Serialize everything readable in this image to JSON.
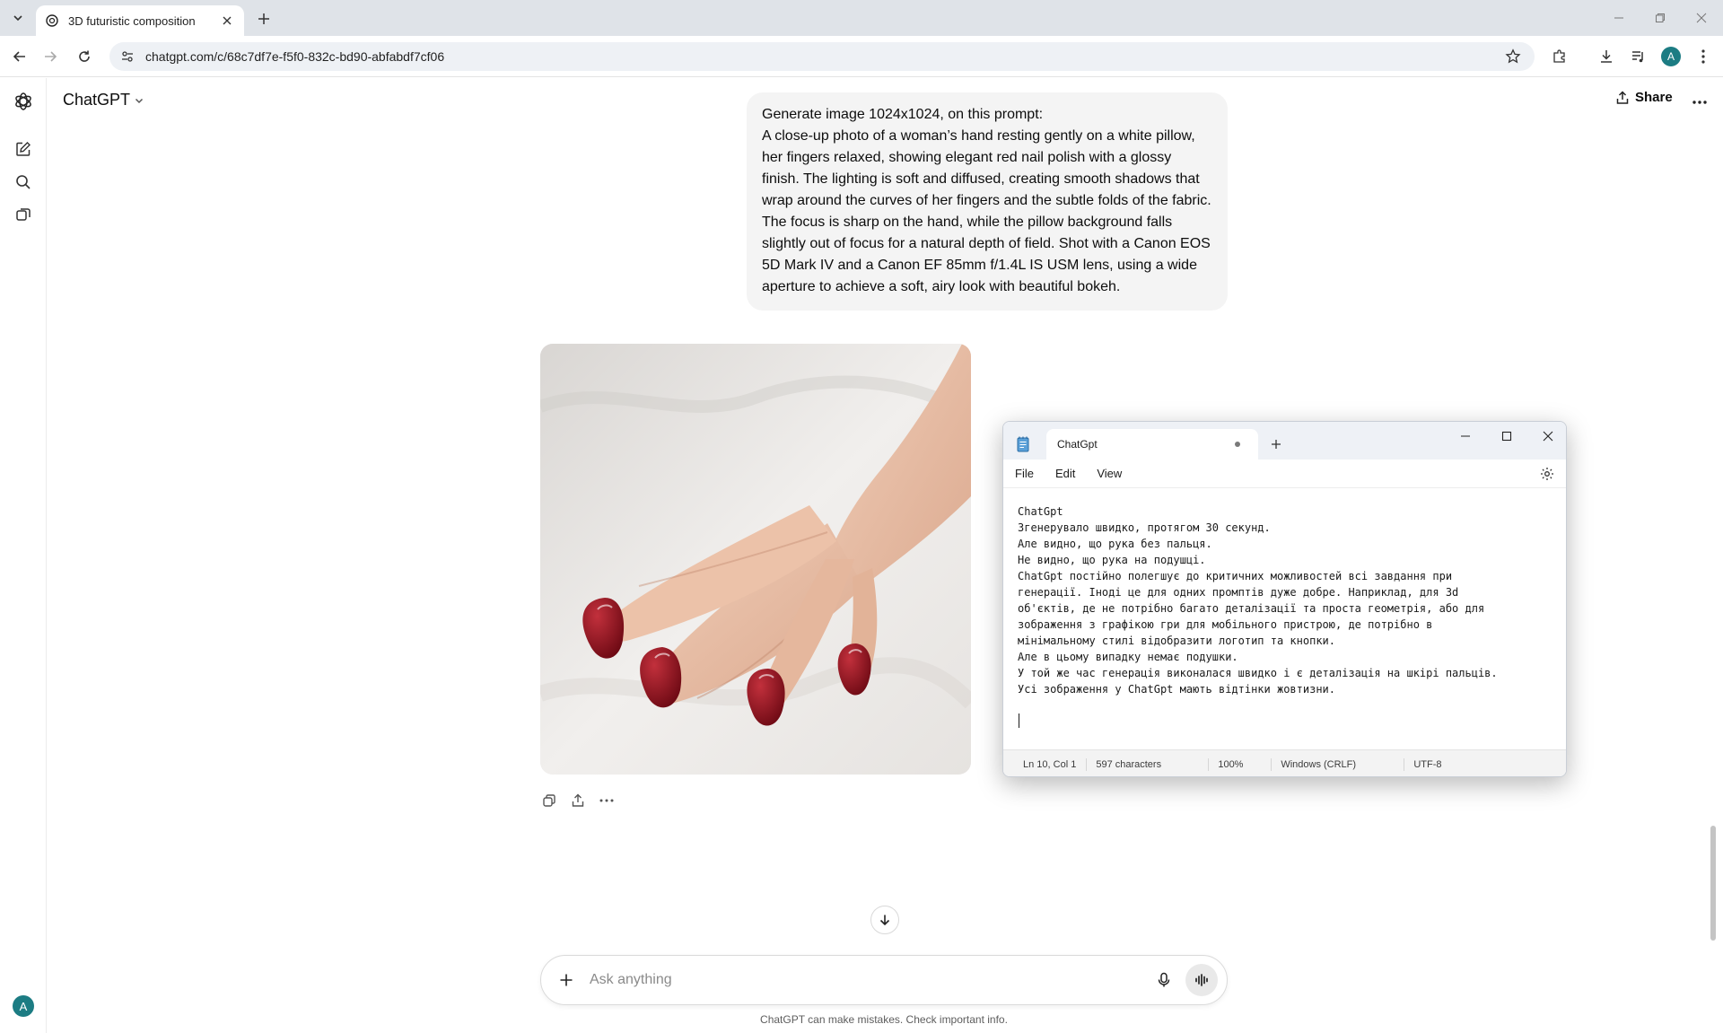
{
  "browser": {
    "tab_title": "3D futuristic composition",
    "url": "chatgpt.com/c/68c7df7e-f5f0-832c-bd90-abfabdf7cf06",
    "profile_initial": "A"
  },
  "chat": {
    "model_name": "ChatGPT",
    "share_label": "Share",
    "user_message_line1": "Generate image 1024x1024, on this prompt:",
    "user_message_body": "A close-up photo of a woman’s hand resting gently on a white pillow, her fingers relaxed, showing elegant red nail polish with a glossy finish. The lighting is soft and diffused, creating smooth shadows that wrap around the curves of her fingers and the subtle folds of the fabric. The focus is sharp on the hand, while the pillow background falls slightly out of focus for a natural depth of field. Shot with a Canon EOS 5D Mark IV and a Canon EF 85mm f/1.4L IS USM lens, using a wide aperture to achieve a soft, airy look with beautiful bokeh.",
    "composer_placeholder": "Ask anything",
    "disclaimer": "ChatGPT can make mistakes. Check important info.",
    "user_avatar_initial": "A"
  },
  "notepad": {
    "tab_title": "ChatGpt",
    "menu": [
      "File",
      "Edit",
      "View"
    ],
    "text": "ChatGpt\nЗгенерувало швидко, протягом 30 секунд.\nАле видно, що рука без пальця.\nНе видно, що рука на подушці.\nChatGpt постійно полегшує до критичних можливостей всі завдання при\nгенерації. Іноді це для одних промптів дуже добре. Наприклад, для 3d\nоб'єктів, де не потрібно багато деталізації та проста геометрія, або для\nзображення з графікою гри для мобільного пристрою, де потрібно в\nмінімальному стилі відобразити логотип та кнопки.\nАле в цьому випадку немає подушки.\nУ той же час генерація виконалася швидко і є деталізація на шкірі пальців.\nУсі зображення у ChatGpt мають відтінки жовтизни.",
    "status": {
      "position": "Ln 10, Col 1",
      "characters": "597 characters",
      "zoom": "100%",
      "line_ending": "Windows (CRLF)",
      "encoding": "UTF-8"
    }
  },
  "colors": {
    "tabstrip_bg": "#dfe3e8",
    "avatar": "#1c7c83",
    "nail_red": "#8e0f1a",
    "user_bubble": "#f4f4f4"
  }
}
